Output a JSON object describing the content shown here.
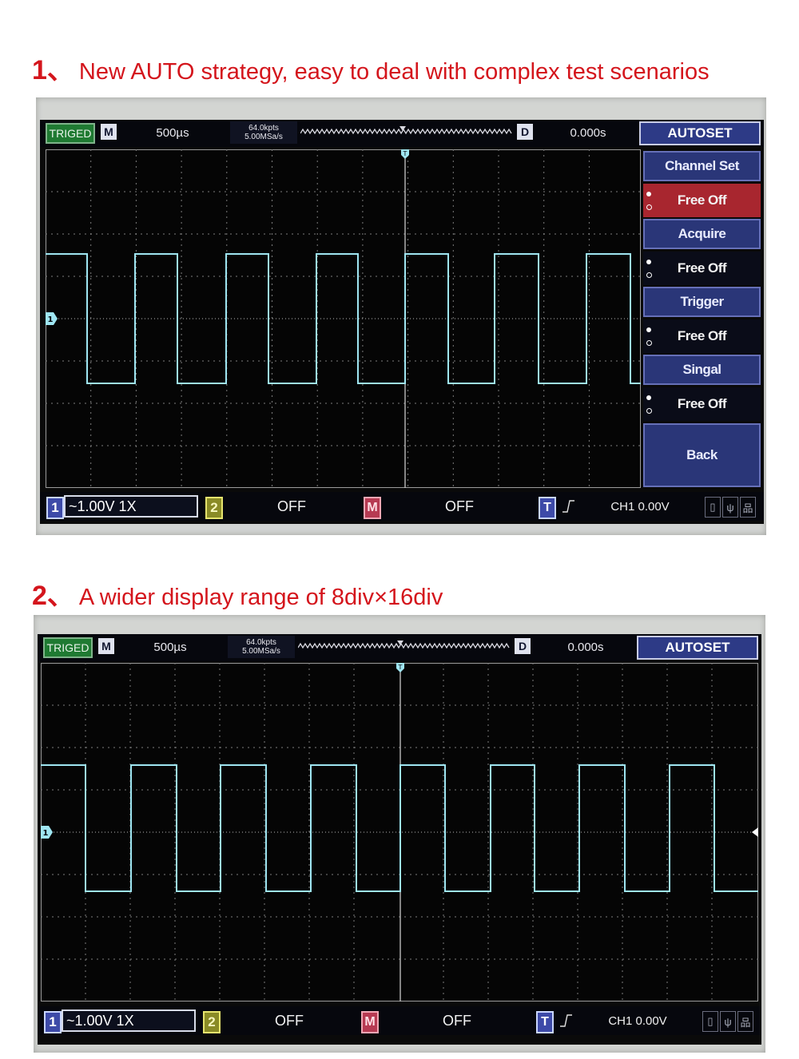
{
  "headings": [
    {
      "num": "1、",
      "text": "New AUTO strategy, easy to deal with complex test scenarios"
    },
    {
      "num": "2、",
      "text": "A wider display range of 8div×16div"
    }
  ],
  "scope": {
    "trig_status": "TRIGED",
    "mode_letter": "M",
    "timebase": "500µs",
    "memory_depth": "64.0kpts",
    "sample_rate": "5.00MSa/s",
    "delay_letter": "D",
    "delay_value": "0.000s",
    "autoset_label": "AUTOSET",
    "ch1_num": "1",
    "ch1_setting": "~1.00V  1X",
    "ch2_num": "2",
    "ch2_state": "OFF",
    "math_letter": "M",
    "math_state": "OFF",
    "trig_letter": "T",
    "trig_slope_icon": "rising-edge-icon",
    "trig_info": "CH1 0.00V",
    "ch1_marker": "1",
    "trigger_pos_marker": "T",
    "status_icons": [
      "usb-drive-icon",
      "usb-icon",
      "lan-icon"
    ],
    "colors": {
      "trace": "#9fe6f2",
      "grid": "#8a8a8a",
      "triged": "#1f7a32",
      "selected": "#a8262f"
    },
    "waveform": {
      "type": "square",
      "levels": [
        "high",
        "low"
      ],
      "cycles_visible": 8
    }
  },
  "menu": {
    "items": [
      {
        "title": "Channel Set",
        "option": "Free Off",
        "selected": true
      },
      {
        "title": "Acquire",
        "option": "Free Off",
        "selected": false
      },
      {
        "title": "Trigger",
        "option": "Free Off",
        "selected": false
      },
      {
        "title": "Singal",
        "option": "Free Off",
        "selected": false
      }
    ],
    "back": "Back"
  }
}
